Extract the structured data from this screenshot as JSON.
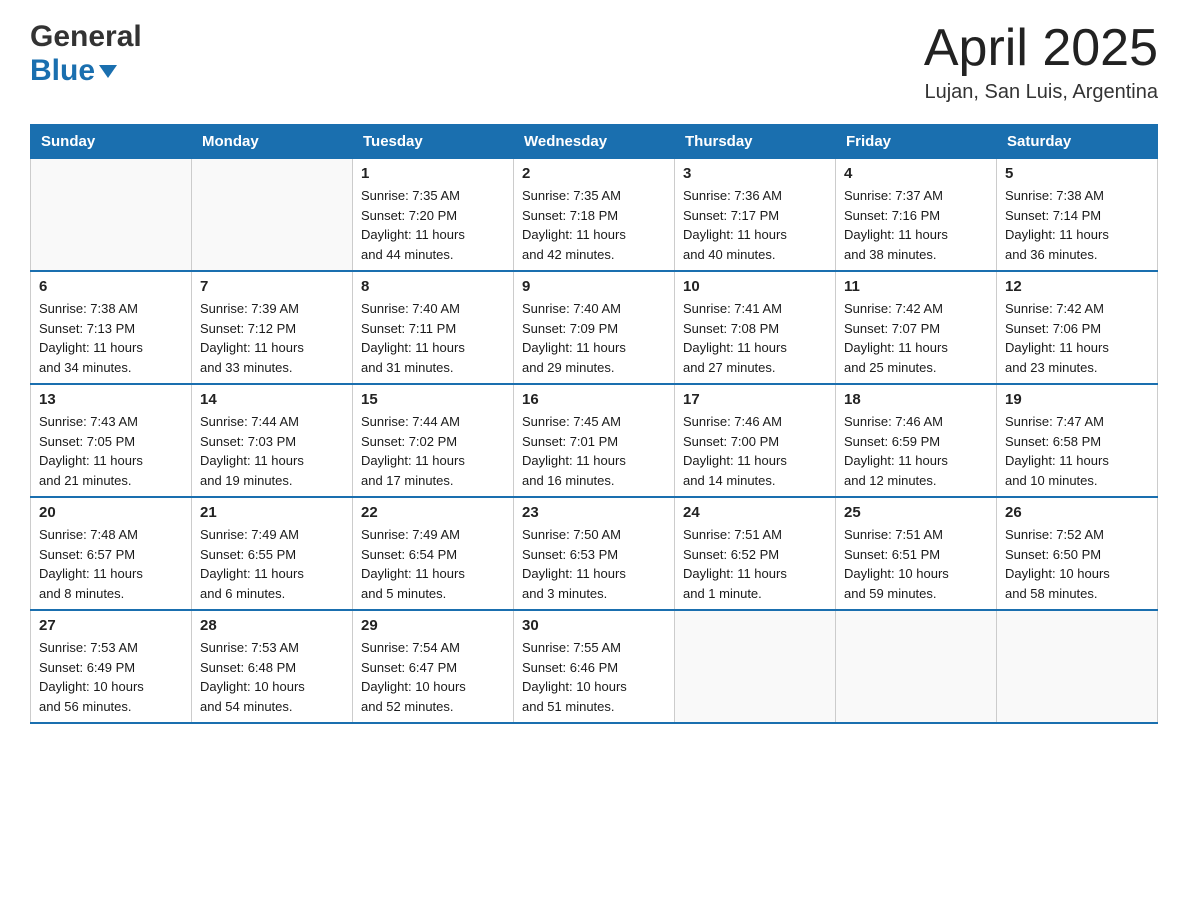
{
  "header": {
    "logo_line1": "General",
    "logo_line2": "Blue",
    "month_title": "April 2025",
    "location": "Lujan, San Luis, Argentina"
  },
  "weekdays": [
    "Sunday",
    "Monday",
    "Tuesday",
    "Wednesday",
    "Thursday",
    "Friday",
    "Saturday"
  ],
  "weeks": [
    [
      {
        "day": "",
        "info": ""
      },
      {
        "day": "",
        "info": ""
      },
      {
        "day": "1",
        "info": "Sunrise: 7:35 AM\nSunset: 7:20 PM\nDaylight: 11 hours\nand 44 minutes."
      },
      {
        "day": "2",
        "info": "Sunrise: 7:35 AM\nSunset: 7:18 PM\nDaylight: 11 hours\nand 42 minutes."
      },
      {
        "day": "3",
        "info": "Sunrise: 7:36 AM\nSunset: 7:17 PM\nDaylight: 11 hours\nand 40 minutes."
      },
      {
        "day": "4",
        "info": "Sunrise: 7:37 AM\nSunset: 7:16 PM\nDaylight: 11 hours\nand 38 minutes."
      },
      {
        "day": "5",
        "info": "Sunrise: 7:38 AM\nSunset: 7:14 PM\nDaylight: 11 hours\nand 36 minutes."
      }
    ],
    [
      {
        "day": "6",
        "info": "Sunrise: 7:38 AM\nSunset: 7:13 PM\nDaylight: 11 hours\nand 34 minutes."
      },
      {
        "day": "7",
        "info": "Sunrise: 7:39 AM\nSunset: 7:12 PM\nDaylight: 11 hours\nand 33 minutes."
      },
      {
        "day": "8",
        "info": "Sunrise: 7:40 AM\nSunset: 7:11 PM\nDaylight: 11 hours\nand 31 minutes."
      },
      {
        "day": "9",
        "info": "Sunrise: 7:40 AM\nSunset: 7:09 PM\nDaylight: 11 hours\nand 29 minutes."
      },
      {
        "day": "10",
        "info": "Sunrise: 7:41 AM\nSunset: 7:08 PM\nDaylight: 11 hours\nand 27 minutes."
      },
      {
        "day": "11",
        "info": "Sunrise: 7:42 AM\nSunset: 7:07 PM\nDaylight: 11 hours\nand 25 minutes."
      },
      {
        "day": "12",
        "info": "Sunrise: 7:42 AM\nSunset: 7:06 PM\nDaylight: 11 hours\nand 23 minutes."
      }
    ],
    [
      {
        "day": "13",
        "info": "Sunrise: 7:43 AM\nSunset: 7:05 PM\nDaylight: 11 hours\nand 21 minutes."
      },
      {
        "day": "14",
        "info": "Sunrise: 7:44 AM\nSunset: 7:03 PM\nDaylight: 11 hours\nand 19 minutes."
      },
      {
        "day": "15",
        "info": "Sunrise: 7:44 AM\nSunset: 7:02 PM\nDaylight: 11 hours\nand 17 minutes."
      },
      {
        "day": "16",
        "info": "Sunrise: 7:45 AM\nSunset: 7:01 PM\nDaylight: 11 hours\nand 16 minutes."
      },
      {
        "day": "17",
        "info": "Sunrise: 7:46 AM\nSunset: 7:00 PM\nDaylight: 11 hours\nand 14 minutes."
      },
      {
        "day": "18",
        "info": "Sunrise: 7:46 AM\nSunset: 6:59 PM\nDaylight: 11 hours\nand 12 minutes."
      },
      {
        "day": "19",
        "info": "Sunrise: 7:47 AM\nSunset: 6:58 PM\nDaylight: 11 hours\nand 10 minutes."
      }
    ],
    [
      {
        "day": "20",
        "info": "Sunrise: 7:48 AM\nSunset: 6:57 PM\nDaylight: 11 hours\nand 8 minutes."
      },
      {
        "day": "21",
        "info": "Sunrise: 7:49 AM\nSunset: 6:55 PM\nDaylight: 11 hours\nand 6 minutes."
      },
      {
        "day": "22",
        "info": "Sunrise: 7:49 AM\nSunset: 6:54 PM\nDaylight: 11 hours\nand 5 minutes."
      },
      {
        "day": "23",
        "info": "Sunrise: 7:50 AM\nSunset: 6:53 PM\nDaylight: 11 hours\nand 3 minutes."
      },
      {
        "day": "24",
        "info": "Sunrise: 7:51 AM\nSunset: 6:52 PM\nDaylight: 11 hours\nand 1 minute."
      },
      {
        "day": "25",
        "info": "Sunrise: 7:51 AM\nSunset: 6:51 PM\nDaylight: 10 hours\nand 59 minutes."
      },
      {
        "day": "26",
        "info": "Sunrise: 7:52 AM\nSunset: 6:50 PM\nDaylight: 10 hours\nand 58 minutes."
      }
    ],
    [
      {
        "day": "27",
        "info": "Sunrise: 7:53 AM\nSunset: 6:49 PM\nDaylight: 10 hours\nand 56 minutes."
      },
      {
        "day": "28",
        "info": "Sunrise: 7:53 AM\nSunset: 6:48 PM\nDaylight: 10 hours\nand 54 minutes."
      },
      {
        "day": "29",
        "info": "Sunrise: 7:54 AM\nSunset: 6:47 PM\nDaylight: 10 hours\nand 52 minutes."
      },
      {
        "day": "30",
        "info": "Sunrise: 7:55 AM\nSunset: 6:46 PM\nDaylight: 10 hours\nand 51 minutes."
      },
      {
        "day": "",
        "info": ""
      },
      {
        "day": "",
        "info": ""
      },
      {
        "day": "",
        "info": ""
      }
    ]
  ]
}
